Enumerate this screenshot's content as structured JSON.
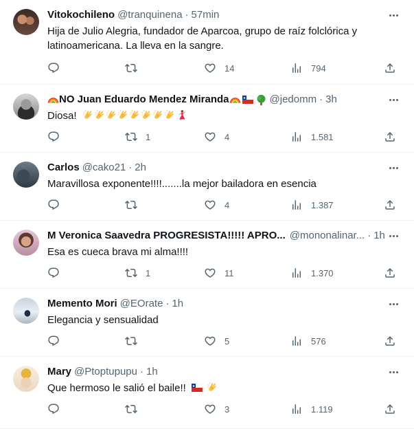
{
  "tweets": [
    {
      "name": "Vitokochileno",
      "handle": "@tranquinena",
      "time": "57min",
      "text_line1": "Hija de Julio Alegria, fundador de Aparcoa, grupo de raíz folclórica y",
      "text_line2": "latinoamericana. La lleva en la sangre.",
      "replies": "",
      "retweets": "",
      "likes": "14",
      "views": "794"
    },
    {
      "name_prefix_emoji": "rainbow",
      "name": "NO Juan Eduardo Mendez Miranda",
      "name_suffix_emojis": [
        "rainbow",
        "chile-flag",
        "tree"
      ],
      "handle": "@jedomm",
      "time": "3h",
      "text": "Diosa!",
      "text_emojis": [
        "clap",
        "clap",
        "clap",
        "clap",
        "clap",
        "clap",
        "clap",
        "clap",
        "dancer"
      ],
      "replies": "",
      "retweets": "1",
      "likes": "4",
      "views": "1.581"
    },
    {
      "name": "Carlos",
      "handle": "@cako21",
      "time": "2h",
      "text": "Maravillosa exponente!!!!.......la mejor bailadora en esencia",
      "replies": "",
      "retweets": "",
      "likes": "4",
      "views": "1.387"
    },
    {
      "name": "M Veronica Saavedra PROGRESISTA!!!!! APRO...",
      "handle": "@mononalinar...",
      "time": "1h",
      "text": "Esa es cueca brava mi alma!!!!",
      "replies": "",
      "retweets": "1",
      "likes": "11",
      "views": "1.370"
    },
    {
      "name": "Memento Mori",
      "handle": "@EOrate",
      "time": "1h",
      "text": "Elegancia y sensualidad",
      "replies": "",
      "retweets": "",
      "likes": "5",
      "views": "576"
    },
    {
      "name": "Mary",
      "handle": "@Ptoptupupu",
      "time": "1h",
      "text": "Que hermoso le salió el baile!!",
      "text_emojis": [
        "chile-flag",
        "clap"
      ],
      "replies": "",
      "retweets": "",
      "likes": "3",
      "views": "1.119"
    }
  ],
  "colors": {
    "text": "#0f1419",
    "secondary": "#536471",
    "divider": "#eff3f4",
    "background": "#ffffff"
  },
  "icons": {
    "more": "more-icon",
    "reply": "reply-icon",
    "retweet": "retweet-icon",
    "like": "heart-icon",
    "views": "views-icon",
    "share": "share-icon"
  }
}
